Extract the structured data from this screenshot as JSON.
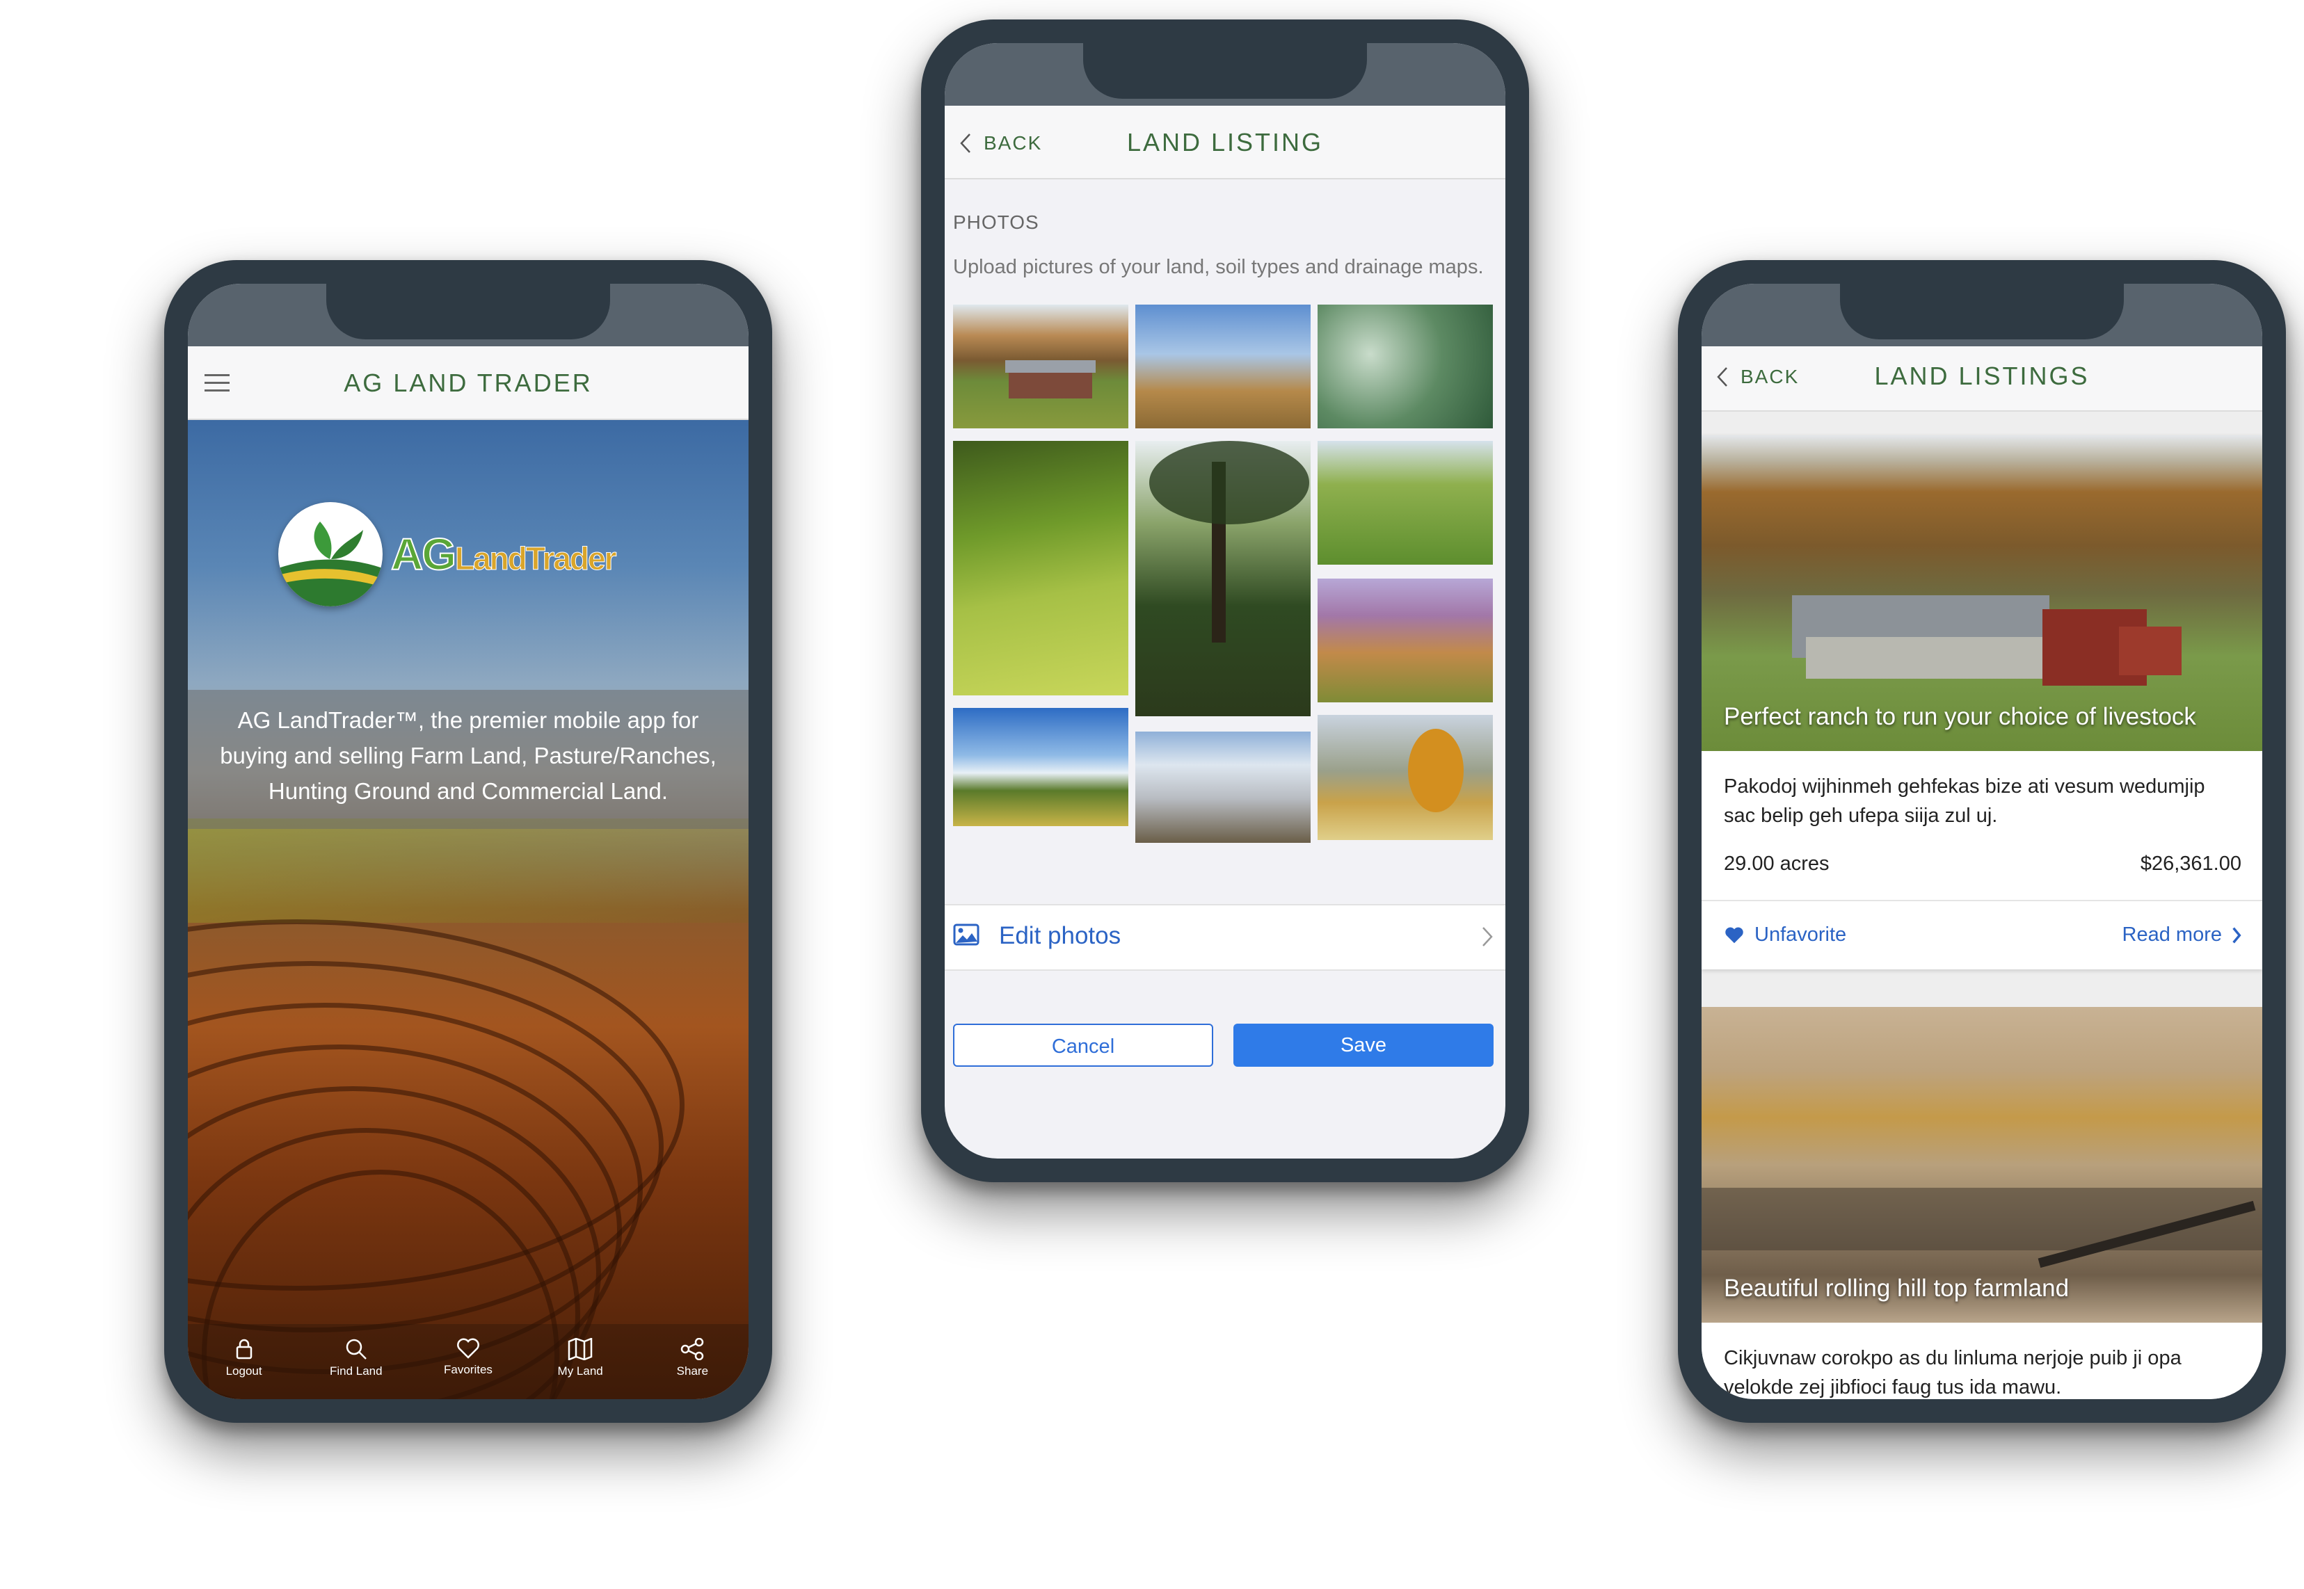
{
  "phone1": {
    "title": "AG LAND TRADER",
    "logo_text": "AG Land Trader",
    "tagline": "AG LandTrader™, the premier mobile app for buying and selling Farm Land, Pasture/Ranches, Hunting Ground and Commercial Land.",
    "tabs": [
      {
        "label": "Logout",
        "icon": "lock-icon"
      },
      {
        "label": "Find Land",
        "icon": "search-icon"
      },
      {
        "label": "Favorites",
        "icon": "heart-icon"
      },
      {
        "label": "My Land",
        "icon": "map-icon"
      },
      {
        "label": "Share",
        "icon": "share-icon"
      }
    ]
  },
  "phone2": {
    "back_label": "BACK",
    "title": "LAND LISTING",
    "section_label": "PHOTOS",
    "upload_hint": "Upload pictures of your land, soil types and drainage maps.",
    "edit_photos_label": "Edit photos",
    "cancel_label": "Cancel",
    "save_label": "Save"
  },
  "phone3": {
    "back_label": "BACK",
    "title": "LAND LISTINGS",
    "listings": [
      {
        "caption": "Perfect ranch to run your choice of livestock",
        "description": "Pakodoj wijhinmeh gehfekas bize ati vesum wedumjip sac belip geh ufepa siija zul uj.",
        "acres": "29.00 acres",
        "price": "$26,361.00",
        "favorite_label": "Unfavorite",
        "read_more_label": "Read more"
      },
      {
        "caption": "Beautiful rolling hill top farmland",
        "description": "Cikjuvnaw corokpo as du linluma nerjoje puib ji opa velokde zej jibfioci faug tus ida mawu."
      }
    ]
  },
  "colors": {
    "accent_green": "#3d6b3e",
    "link_blue": "#2b63c4",
    "save_blue": "#2f7be8",
    "phone_frame": "#2e3a44"
  }
}
